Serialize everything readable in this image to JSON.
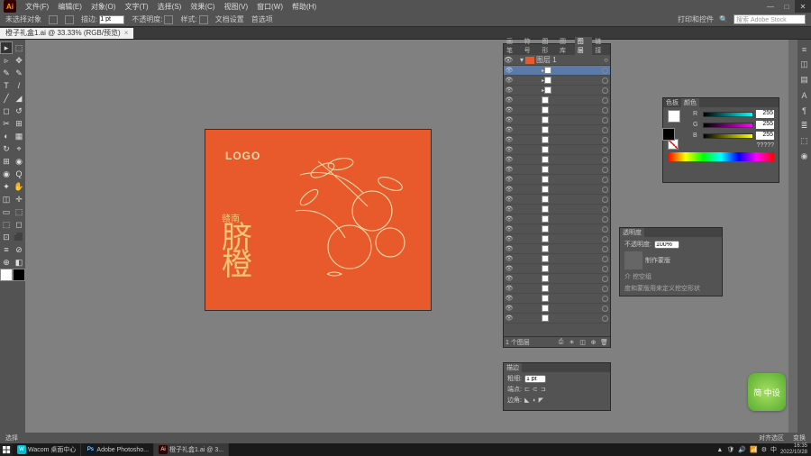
{
  "menu": [
    "文件(F)",
    "编辑(E)",
    "对象(O)",
    "文字(T)",
    "选择(S)",
    "效果(C)",
    "视图(V)",
    "窗口(W)",
    "帮助(H)"
  ],
  "win_buttons": {
    "min": "—",
    "max": "□",
    "close": "✕"
  },
  "stock_search_placeholder": "搜索 Adobe Stock",
  "print_btn": "打印和控件",
  "option": {
    "noselect": "未选择对象",
    "stroke_label": "描边:",
    "stroke_val": "1 pt",
    "opacity_label": "不透明度:",
    "style_label": "样式:",
    "docsetup": "文档设置",
    "prefs": "首选项"
  },
  "tab": {
    "title": "橙子礼盒1.ai @ 33.33% (RGB/预览)",
    "close": "×"
  },
  "tools_left": [
    "▸",
    "▹",
    "✎",
    "T",
    "╱",
    "◻",
    "✂",
    "◐",
    "↻",
    "⊞",
    "◉",
    "✦",
    "◫",
    "▭",
    "⬚",
    "⊡",
    "≡",
    "⊕"
  ],
  "tools_right": [
    "⬚",
    "✥",
    "✎",
    "/",
    "◢",
    "↺",
    "⊞",
    "▦",
    "⌖",
    "◉",
    "Q",
    "✋",
    "✛",
    "⬚",
    "◻",
    "⬛",
    "⊘",
    "◧"
  ],
  "artboard": {
    "logo": "LOGO",
    "sub": "赣南",
    "main1": "脐",
    "main2": "橙"
  },
  "zoom": {
    "pct": "33.33%",
    "sel": "选择"
  },
  "vstrip": [
    "≡",
    "◫",
    "▤",
    "A",
    "¶",
    "≣",
    "⬚",
    "◉"
  ],
  "layers": {
    "tabs": [
      "画笔",
      "符号",
      "图形",
      "图库",
      "图层",
      "链接"
    ],
    "active_tab": "图层",
    "top": "图层 1",
    "count": 26,
    "footer_label": "1 个图层",
    "footer_icons": [
      "⎙",
      "☀",
      "◫",
      "⊕",
      "🗑"
    ]
  },
  "stroke": {
    "tab": "描边",
    "weight_lbl": "粗细:",
    "weight": "1 pt",
    "cap_lbl": "端点:",
    "corner_lbl": "边角:"
  },
  "color": {
    "tabs": [
      "色板",
      "颜色"
    ],
    "r": "255",
    "g": "255",
    "b": "255",
    "q": "?????"
  },
  "trans": {
    "tab": "透明度",
    "opacity_lbl": "不透明度:",
    "opacity": "100%",
    "mask_lbl": "制作蒙版",
    "clip": "介 挖空组",
    "desc": "度和蒙版用来定义挖空形状"
  },
  "badge": "简\n中设",
  "taskbar": {
    "items": [
      {
        "ico_bg": "#00bcd4",
        "ico": "W",
        "label": "Wacom 桌面中心"
      },
      {
        "ico_bg": "#001e36",
        "ico": "Ps",
        "label": "Adobe Photosho..."
      },
      {
        "ico_bg": "#330000",
        "ico": "Ai",
        "label": "橙子礼盒1.ai @ 3..."
      }
    ],
    "tray_icons": [
      "🛡",
      "🔊",
      "📶",
      "⚙",
      "中"
    ],
    "time": "16:35",
    "date": "2022/10/28"
  },
  "status": {
    "align": "对齐选区",
    "transform": "变换"
  }
}
